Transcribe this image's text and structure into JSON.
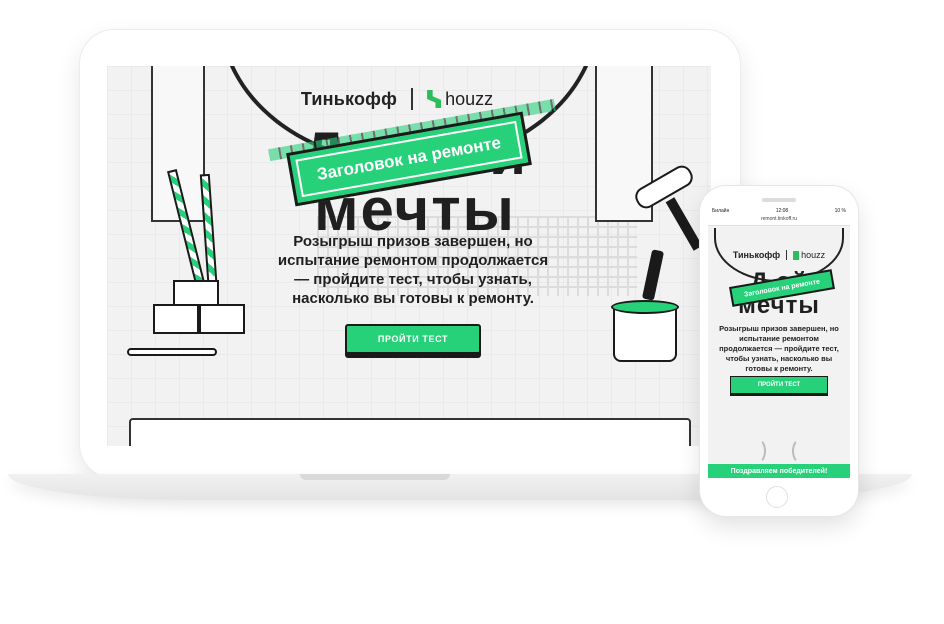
{
  "desktop": {
    "brand_left": "Тинькофф",
    "brand_right": "houzz",
    "headline": "Дом мечты",
    "headline_line1": "Дом     ой",
    "headline_line2": "мечты",
    "tape_text": "Заголовок на ремонте",
    "lead": "Розыгрыш призов завершен, но испытание ремонтом продолжается — пройдите тест, чтобы узнать, насколько вы готовы к ремонту.",
    "cta_label": "ПРОЙТИ ТЕСТ"
  },
  "mobile": {
    "status_carrier": "Билайн",
    "status_time": "12:08",
    "status_battery": "10 %",
    "url": "remont.tinkoff.ru",
    "brand_left": "Тинькофф",
    "brand_right": "houzz",
    "headline_line1": "Д      ой",
    "headline_line2": "мечты",
    "tape_text": "Заголовок на ремонте",
    "lead": "Розыгрыш призов завершен, но испытание ремонтом продолжается — пройдите тест, чтобы узнать, насколько вы готовы к ремонту.",
    "cta_label": "ПРОЙТИ ТЕСТ",
    "winners_label": "Поздравляем победителей!"
  },
  "colors": {
    "accent": "#27d17a",
    "houzz_green": "#2dbd5a",
    "ink": "#1a1a1a",
    "page_bg": "#f2f2f2"
  }
}
